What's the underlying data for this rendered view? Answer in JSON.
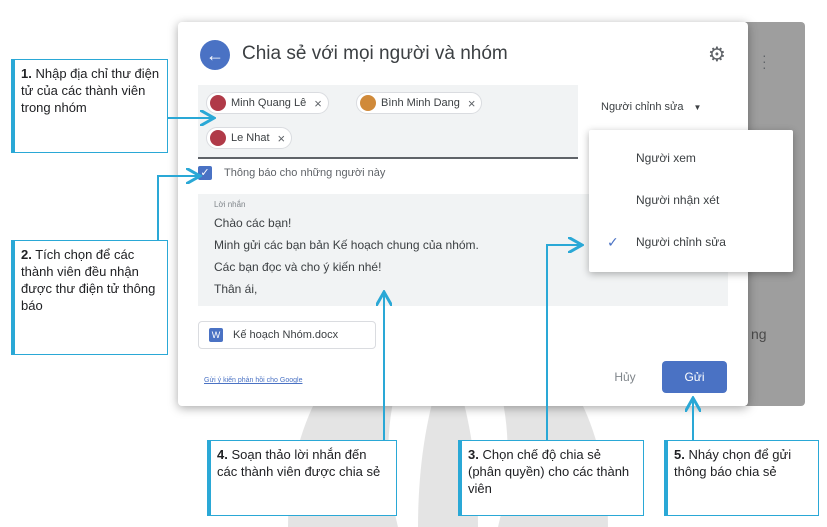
{
  "dialog": {
    "title": "Chia sẻ với mọi người và nhóm",
    "recipients": [
      {
        "name": "Minh Quang Lê",
        "avatar_color": "#b03a48"
      },
      {
        "name": "Bình Minh Dang",
        "avatar_color": "#d08a3a"
      },
      {
        "name": "Le Nhat",
        "avatar_color": "#b03a48"
      }
    ],
    "remove_glyph": "×",
    "role_selected": "Người chỉnh sửa",
    "notify_label": "Thông báo cho những người này",
    "message_label": "Lời nhắn",
    "message_lines": [
      "Chào các bạn!",
      "Minh gửi các bạn bản Kế hoạch chung của nhóm.",
      "Các bạn đọc và cho ý kiến nhé!",
      "Thân ái,"
    ],
    "attachment": "Kế hoạch Nhóm.docx",
    "attachment_icon": "W",
    "feedback_link": "Gửi ý kiến phản hồi cho Google",
    "cancel_label": "Hủy",
    "send_label": "Gửi"
  },
  "dropdown": {
    "items": [
      "Người xem",
      "Người nhận xét",
      "Người chỉnh sửa"
    ],
    "selected_index": 2
  },
  "background": {
    "partial_text": "ng"
  },
  "callouts": [
    {
      "num": "1.",
      "text": "Nhập địa chỉ thư điện tử của các thành viên trong nhóm"
    },
    {
      "num": "2.",
      "text": "Tích chọn để các thành viên đều nhận được thư điện tử thông báo"
    },
    {
      "num": "3.",
      "text": "Chọn chế độ chia sẻ (phân quyền) cho các thành viên"
    },
    {
      "num": "4.",
      "text": "Soạn thảo lời nhắn đến các thành viên được chia sẻ"
    },
    {
      "num": "5.",
      "text": "Nháy chọn để gửi thông báo chia sẻ"
    }
  ],
  "colors": {
    "accent": "#4a72c4",
    "callout_border": "#2aa8d6"
  }
}
